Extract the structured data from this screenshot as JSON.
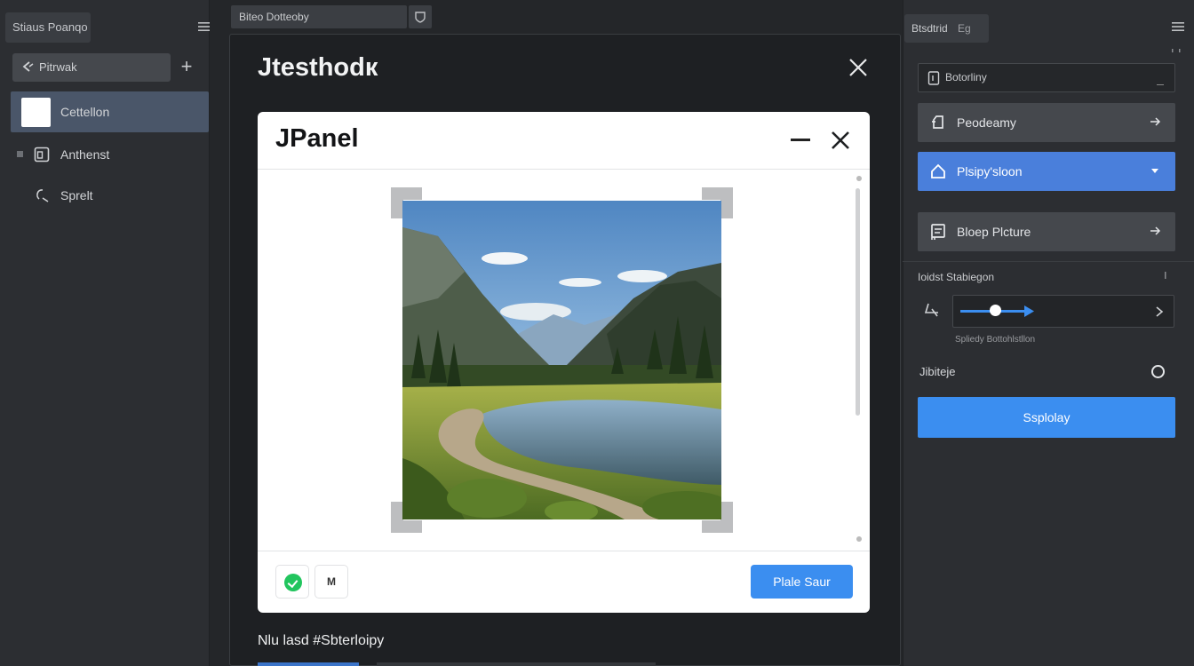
{
  "left_sidebar": {
    "tab_label": "Stiaus Poanqo",
    "search_label": "Pitrwak",
    "items": [
      {
        "label": "Cettellon"
      },
      {
        "label": "Anthenst"
      },
      {
        "label": "Sprelt"
      }
    ]
  },
  "top_tab": {
    "label": "Biteo Dotteoby"
  },
  "dialog": {
    "title": "Jtesthodк",
    "footer_label": "Nlu lasd #Sbterloipy"
  },
  "panel": {
    "title": "JPanel",
    "icon_button_m": "M",
    "save_label": "Plale Saur"
  },
  "right_panel": {
    "tab_label": "Btsdtrid",
    "tab_suffix": "Eg",
    "field_label": "Botorliny",
    "buttons": [
      {
        "label": "Peodeamy",
        "icon": "brush-icon"
      },
      {
        "label": "Plsipy'sloon",
        "icon": "home-icon"
      },
      {
        "label": "Bloep Plcture",
        "icon": "document-icon"
      }
    ],
    "section_label": "Ioidst Stabiegon",
    "slider_caption": "Spliedy Bottohlstllon",
    "slider_value": 0.45,
    "toggle_label": "Jibiteje",
    "display_label": "Ssplolay"
  },
  "colors": {
    "accent": "#3b8ef0",
    "selected_item": "#4a5669",
    "active_button": "#4a7fdb",
    "success": "#22c55e"
  }
}
